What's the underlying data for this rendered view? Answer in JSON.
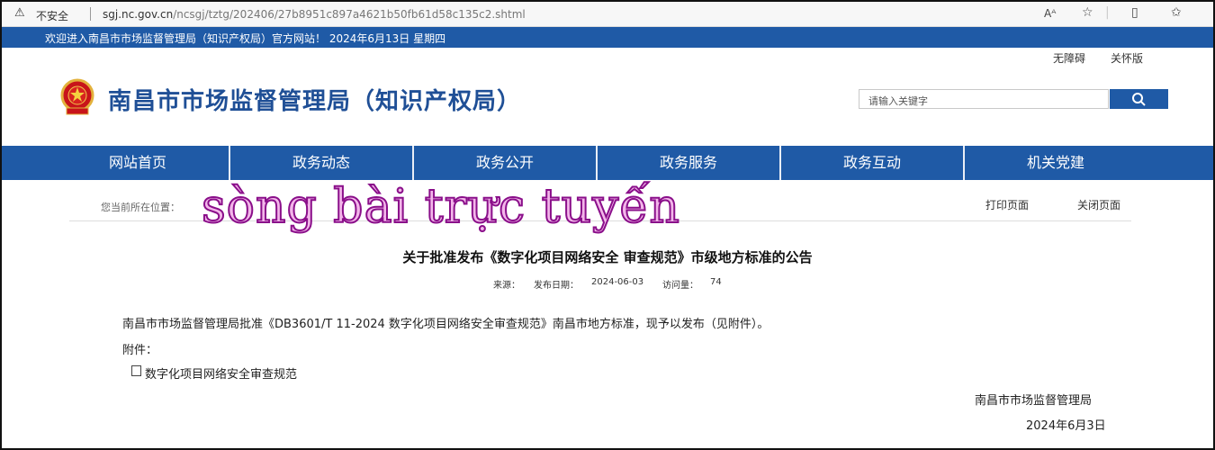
{
  "browser": {
    "warning_label": "不安全",
    "url_host": "sgj.nc.gov.cn",
    "url_path": "/ncsgj/tztg/202406/27b8951c897a4621b50fb61d58c135c2.shtml",
    "icons": [
      "warning-icon",
      "read-aloud-icon",
      "favorite-icon",
      "split-screen-icon",
      "favorites-bar-icon"
    ]
  },
  "topstrip": {
    "welcome": "欢迎进入南昌市市场监督管理局（知识产权局）官方网站！  2024年6月13日  星期四"
  },
  "header": {
    "links": [
      "无障碍",
      "关怀版"
    ],
    "title": "南昌市市场监督管理局（知识产权局）",
    "search_placeholder": "请输入关键字",
    "accent_color": "#1f5aa6"
  },
  "nav": {
    "items": [
      "网站首页",
      "政务动态",
      "政务公开",
      "政务服务",
      "政务互动",
      "机关党建"
    ]
  },
  "breadcrumb": {
    "label": "您当前所在位置：",
    "actions": [
      "打印页面",
      "关闭页面"
    ]
  },
  "watermark": "sòng bài trực tuyến",
  "article": {
    "title": "关于批准发布《数字化项目网络安全 审查规范》市级地方标准的公告",
    "source_label": "来源：",
    "date_label": "发布日期：",
    "date": "2024-06-03",
    "views_label": "访问量：",
    "views": "74",
    "body": "南昌市市场监督管理局批准《DB3601/T 11-2024  数字化项目网络安全审查规范》南昌市地方标准，现予以发布（见附件）。",
    "attachment_label": "附件：",
    "attachment": "数字化项目网络安全审查规范",
    "signature": "南昌市市场监督管理局",
    "sign_date": "2024年6月3日"
  }
}
